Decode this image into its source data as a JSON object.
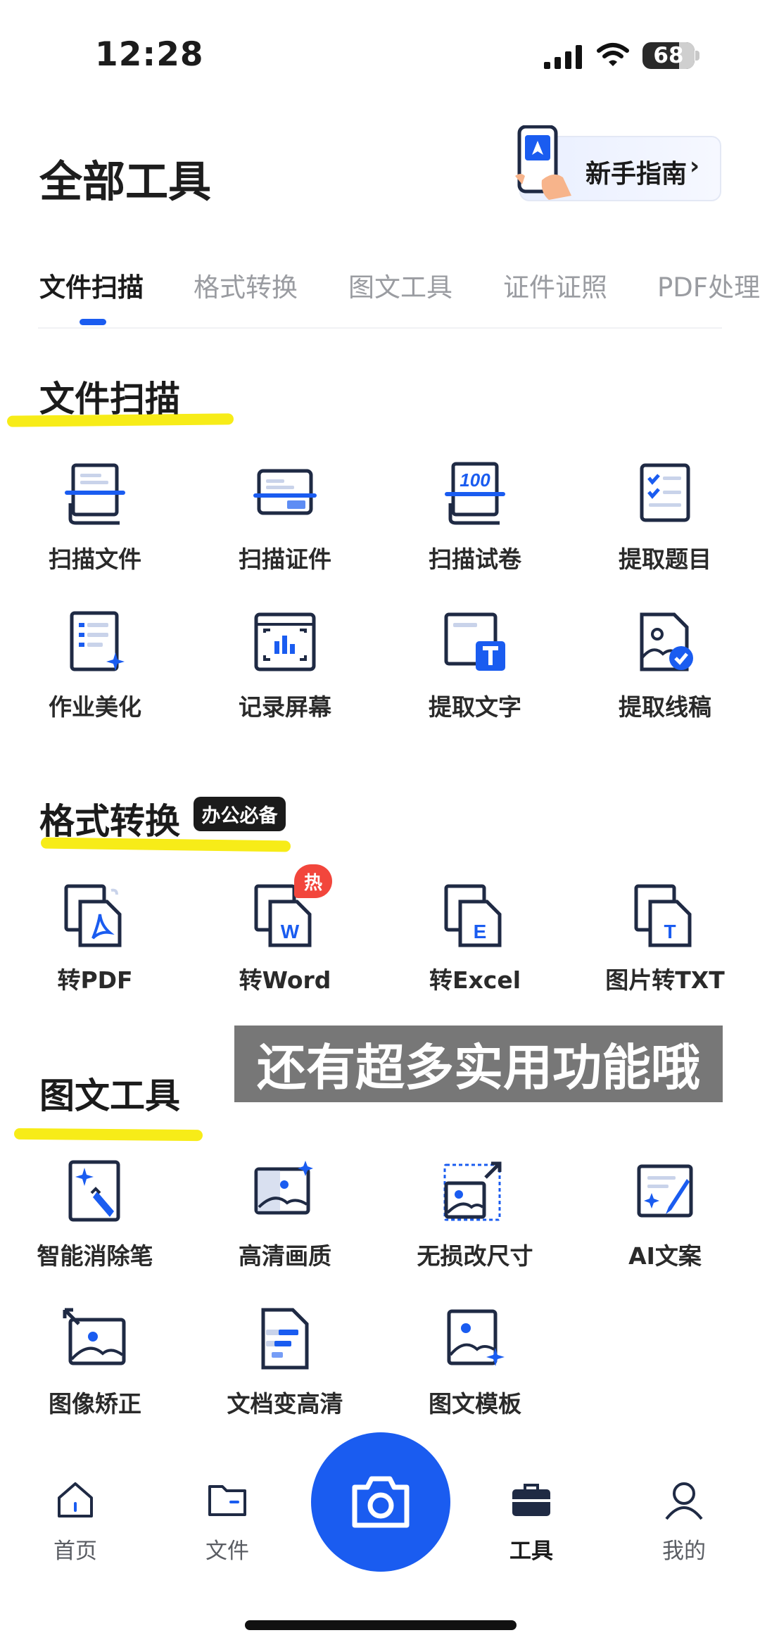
{
  "status_bar": {
    "time": "12:28",
    "battery": "68"
  },
  "header": {
    "title": "全部工具",
    "guide_label": "新手指南",
    "guide_chevron": "›"
  },
  "tabs": [
    "文件扫描",
    "格式转换",
    "图文工具",
    "证件证照",
    "PDF处理"
  ],
  "active_tab": 0,
  "sections": {
    "scan": {
      "title": "文件扫描",
      "tools": [
        {
          "label": "扫描文件",
          "icon": "scan-document-icon"
        },
        {
          "label": "扫描证件",
          "icon": "scan-id-card-icon"
        },
        {
          "label": "扫描试卷",
          "icon": "scan-exam-icon"
        },
        {
          "label": "提取题目",
          "icon": "extract-questions-icon"
        },
        {
          "label": "作业美化",
          "icon": "homework-beautify-icon"
        },
        {
          "label": "记录屏幕",
          "icon": "record-screen-icon"
        },
        {
          "label": "提取文字",
          "icon": "extract-text-icon"
        },
        {
          "label": "提取线稿",
          "icon": "extract-lineart-icon"
        }
      ]
    },
    "convert": {
      "title": "格式转换",
      "badge": "办公必备",
      "hot_label": "热",
      "tools": [
        {
          "label": "转PDF",
          "icon": "to-pdf-icon"
        },
        {
          "label": "转Word",
          "icon": "to-word-icon"
        },
        {
          "label": "转Excel",
          "icon": "to-excel-icon"
        },
        {
          "label": "图片转TXT",
          "icon": "image-to-txt-icon"
        }
      ]
    },
    "image": {
      "title": "图文工具",
      "tools": [
        {
          "label": "智能消除笔",
          "icon": "smart-eraser-icon"
        },
        {
          "label": "高清画质",
          "icon": "hd-quality-icon"
        },
        {
          "label": "无损改尺寸",
          "icon": "lossless-resize-icon"
        },
        {
          "label": "AI文案",
          "icon": "ai-copywriting-icon"
        },
        {
          "label": "图像矫正",
          "icon": "image-correction-icon"
        },
        {
          "label": "文档变高清",
          "icon": "document-hd-icon"
        },
        {
          "label": "图文模板",
          "icon": "image-template-icon"
        }
      ]
    }
  },
  "overlay_caption": "还有超多实用功能哦",
  "bottom_nav": [
    {
      "label": "首页",
      "icon": "home-icon"
    },
    {
      "label": "文件",
      "icon": "folder-icon"
    },
    {
      "label": "工具",
      "icon": "toolbox-icon"
    },
    {
      "label": "我的",
      "icon": "profile-icon"
    }
  ],
  "camera_icon": "camera-icon",
  "colors": {
    "accent": "#1a5cf0",
    "highlight": "#f7ec18",
    "hot": "#f2463c"
  }
}
